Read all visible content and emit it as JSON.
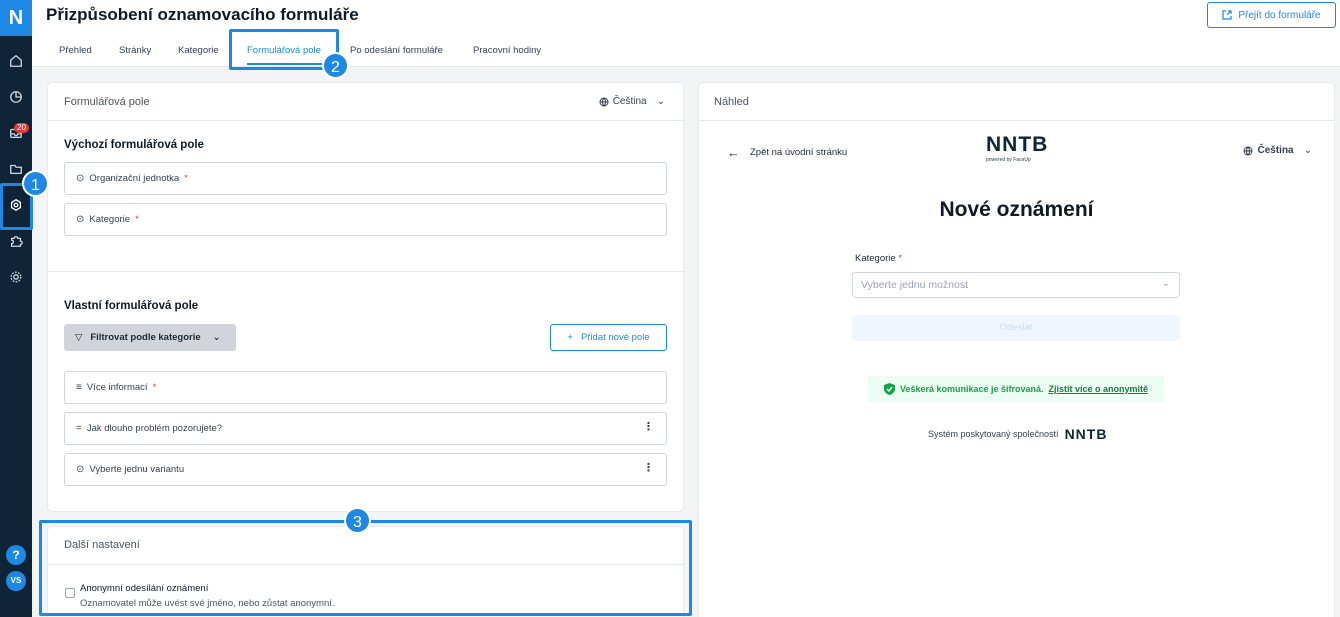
{
  "app": {
    "logo_letter": "N",
    "inbox_badge": "20",
    "help": "?",
    "avatar_initials": "VS"
  },
  "header": {
    "title": "Přizpůsobení oznamovacího formuláře",
    "goto_button": "Přejít do formuláře"
  },
  "tabs": [
    {
      "label": "Přehled"
    },
    {
      "label": "Stránky"
    },
    {
      "label": "Kategorie"
    },
    {
      "label": "Formulářová pole",
      "active": true
    },
    {
      "label": "Po odeslání formuláře"
    },
    {
      "label": "Pracovní hodiny"
    }
  ],
  "form_fields": {
    "panel_title": "Formulářová pole",
    "language": "Čeština",
    "default_title": "Výchozí formulářová pole",
    "default_fields": [
      {
        "label": "Organizační jednotka",
        "required": "*"
      },
      {
        "label": "Kategorie",
        "required": "*"
      }
    ],
    "custom_title": "Vlastní formulářová pole",
    "filter_button": "Filtrovat podle kategorie",
    "add_button": "Přidat nové pole",
    "custom_fields": [
      {
        "label": "Více informací",
        "required": "*"
      },
      {
        "label": "Jak dlouho problém pozorujete?",
        "menu": "⋮"
      },
      {
        "label": "Vyberte jednu variantu",
        "menu": "⋮"
      }
    ]
  },
  "more_settings": {
    "title": "Další nastavení",
    "anonymous_label": "Anonymní odesílání oznámení",
    "anonymous_desc": "Oznamovatel může uvést své jméno, nebo zůstat anonymní."
  },
  "preview": {
    "panel_title": "Náhled",
    "back_link": "Zpět na úvodní stránku",
    "logo_text": "NNTB",
    "logo_powered": "powered by FaceUp",
    "language": "Čeština",
    "title": "Nové oznámení",
    "category_label": "Kategorie",
    "category_required": "*",
    "select_placeholder": "Vyberte jednu možnost",
    "submit": "Odeslat",
    "secure_text": "Veškerá komunikace je šifrovaná.",
    "secure_link": "Zjistit více o anonymitě",
    "system_text": "Systém poskytovaný společností",
    "system_logo": "NNTB"
  },
  "callouts": [
    "1",
    "2",
    "3"
  ],
  "colors": {
    "accent": "#1e88e5",
    "sidebar": "#0f2436",
    "danger": "#e53935",
    "success": "#16a34a"
  }
}
